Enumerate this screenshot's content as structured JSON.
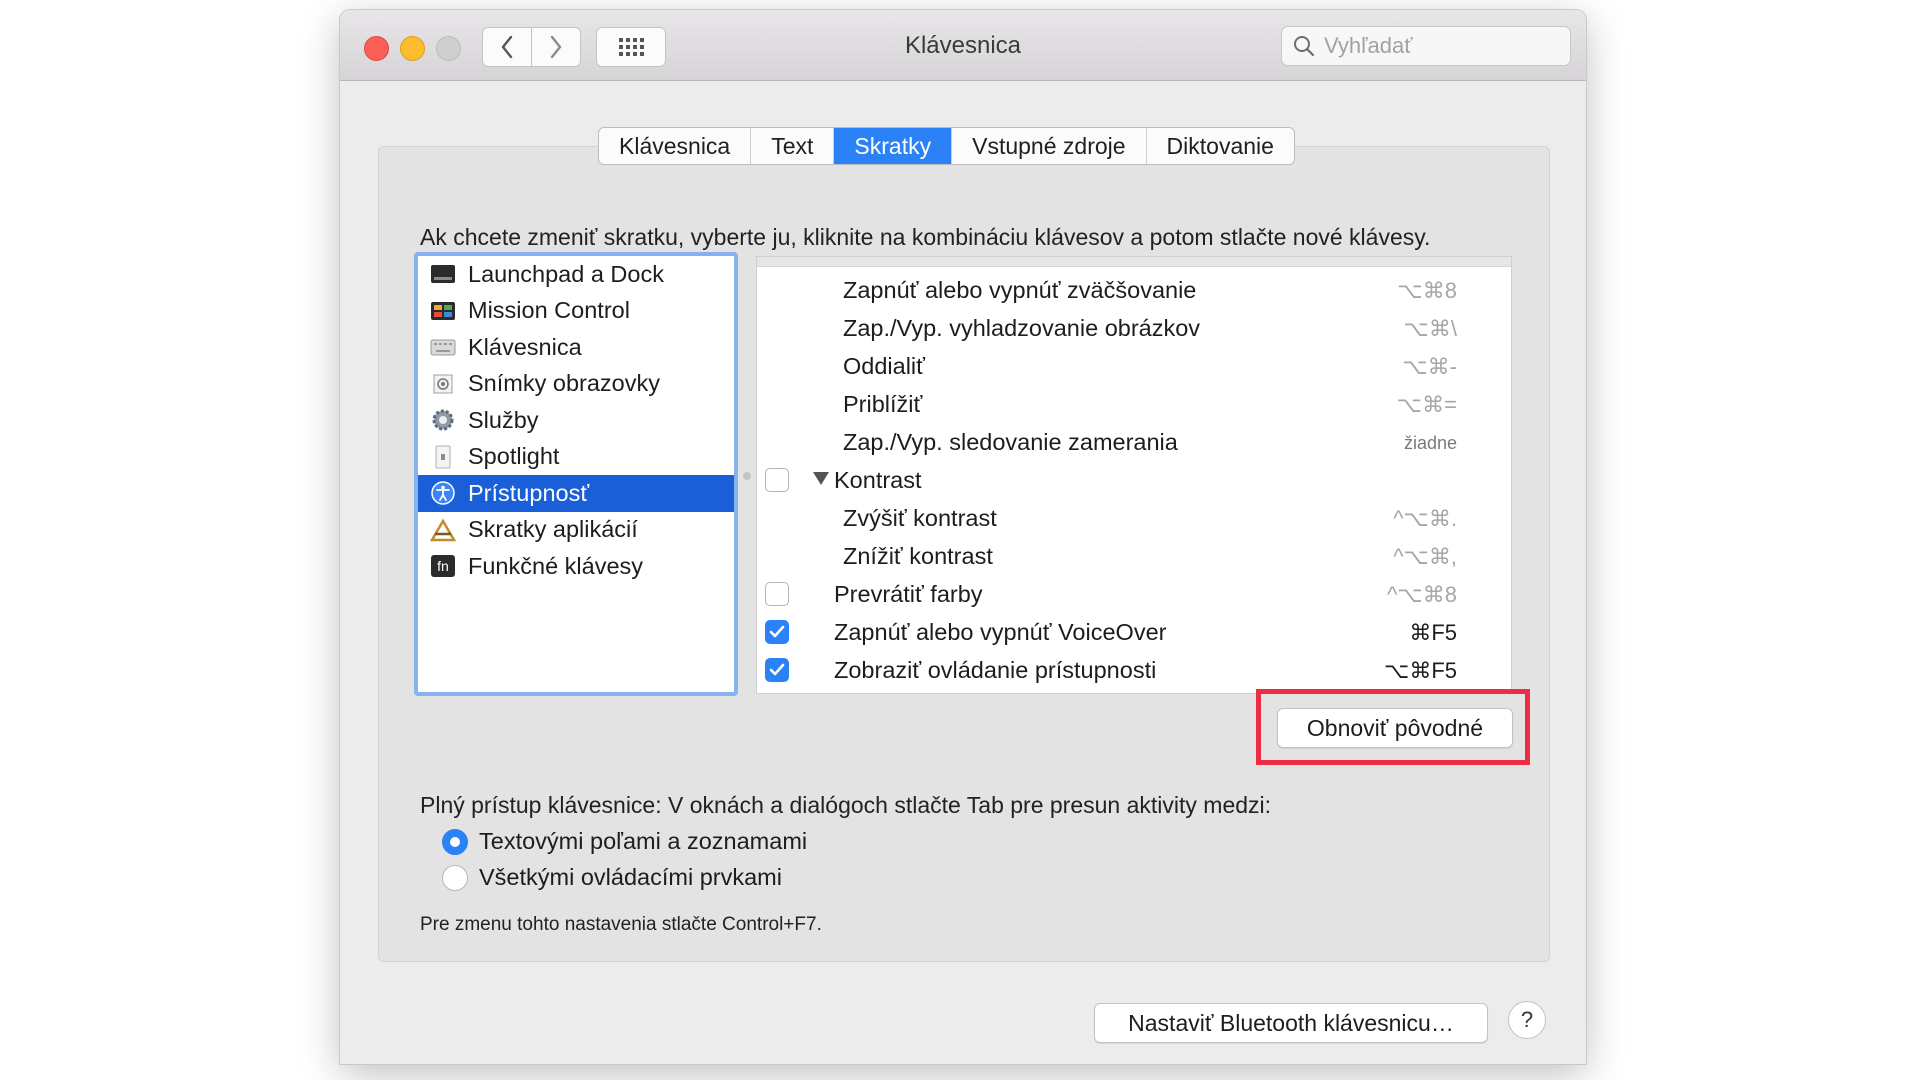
{
  "window": {
    "title": "Klávesnica",
    "search_placeholder": "Vyhľadať"
  },
  "tabs": [
    {
      "label": "Klávesnica"
    },
    {
      "label": "Text"
    },
    {
      "label": "Skratky",
      "active": true
    },
    {
      "label": "Vstupné zdroje"
    },
    {
      "label": "Diktovanie"
    }
  ],
  "instruction": "Ak chcete zmeniť skratku, vyberte ju, kliknite na kombináciu klávesov a potom stlačte nové klávesy.",
  "categories": [
    {
      "label": "Launchpad a Dock",
      "icon": "launchpad-icon"
    },
    {
      "label": "Mission Control",
      "icon": "mission-control-icon"
    },
    {
      "label": "Klávesnica",
      "icon": "keyboard-icon"
    },
    {
      "label": "Snímky obrazovky",
      "icon": "screenshot-icon"
    },
    {
      "label": "Služby",
      "icon": "gear-icon"
    },
    {
      "label": "Spotlight",
      "icon": "spotlight-icon"
    },
    {
      "label": "Prístupnosť",
      "icon": "accessibility-icon",
      "selected": true
    },
    {
      "label": "Skratky aplikácií",
      "icon": "app-shortcuts-icon"
    },
    {
      "label": "Funkčné klávesy",
      "icon": "fn-key-icon"
    }
  ],
  "shortcuts": [
    {
      "label": "Zapnúť alebo vypnúť zväčšovanie",
      "key": "⌥⌘8"
    },
    {
      "label": "Zap./Vyp. vyhladzovanie obrázkov",
      "key": "⌥⌘\\"
    },
    {
      "label": "Oddialiť",
      "key": "⌥⌘-"
    },
    {
      "label": "Priblížiť",
      "key": "⌥⌘="
    },
    {
      "label": "Zap./Vyp. sledovanie zamerania",
      "key": "žiadne"
    },
    {
      "label": "Kontrast",
      "key": ""
    },
    {
      "label": "Zvýšiť kontrast",
      "key": "^⌥⌘."
    },
    {
      "label": "Znížiť kontrast",
      "key": "^⌥⌘,"
    },
    {
      "label": "Prevrátiť farby",
      "key": "^⌥⌘8"
    },
    {
      "label": "Zapnúť alebo vypnúť VoiceOver",
      "key": "⌘F5",
      "checked": true
    },
    {
      "label": "Zobraziť ovládanie prístupnosti",
      "key": "⌥⌘F5",
      "checked": true
    }
  ],
  "restore_button": "Obnoviť pôvodné",
  "keyboard_access": {
    "text": "Plný prístup klávesnice: V oknách a dialógoch stlačte Tab pre presun aktivity medzi:",
    "options": [
      {
        "label": "Textovými poľami a zoznamami",
        "selected": true
      },
      {
        "label": "Všetkými ovládacími prvkami",
        "selected": false
      }
    ],
    "hint": "Pre zmenu tohto nastavenia stlačte Control+F7."
  },
  "bluetooth_button": "Nastaviť Bluetooth klávesnicu…",
  "help_button": "?",
  "colors": {
    "accent": "#2a82f6",
    "selection": "#1b5fd8",
    "highlight": "#ed2c45"
  }
}
